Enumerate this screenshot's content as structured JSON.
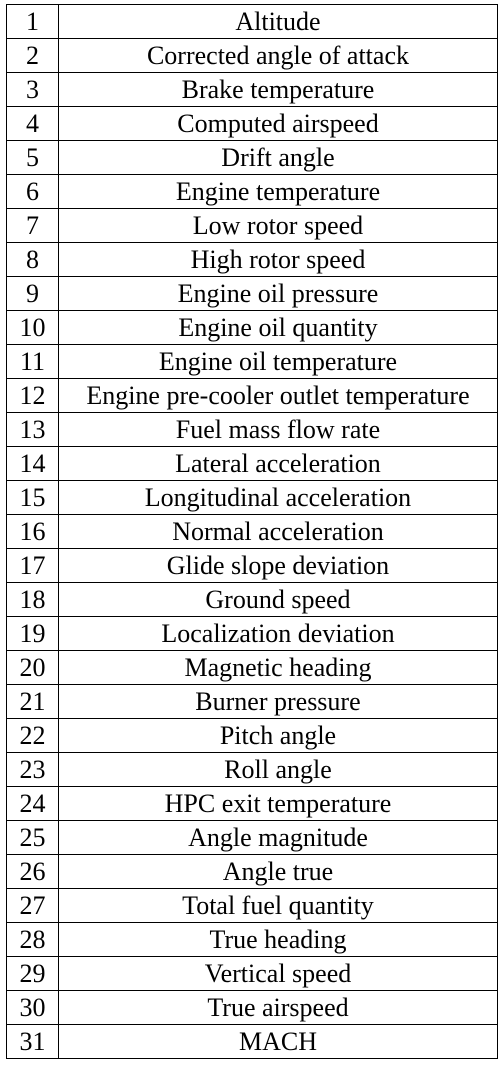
{
  "table": {
    "rows": [
      {
        "n": "1",
        "label": "Altitude"
      },
      {
        "n": "2",
        "label": "Corrected angle of attack"
      },
      {
        "n": "3",
        "label": "Brake temperature"
      },
      {
        "n": "4",
        "label": "Computed airspeed"
      },
      {
        "n": "5",
        "label": "Drift angle"
      },
      {
        "n": "6",
        "label": "Engine temperature"
      },
      {
        "n": "7",
        "label": "Low rotor speed"
      },
      {
        "n": "8",
        "label": "High rotor speed"
      },
      {
        "n": "9",
        "label": "Engine oil pressure"
      },
      {
        "n": "10",
        "label": "Engine oil quantity"
      },
      {
        "n": "11",
        "label": "Engine oil temperature"
      },
      {
        "n": "12",
        "label": "Engine pre-cooler outlet temperature"
      },
      {
        "n": "13",
        "label": "Fuel mass flow rate"
      },
      {
        "n": "14",
        "label": "Lateral acceleration"
      },
      {
        "n": "15",
        "label": "Longitudinal acceleration"
      },
      {
        "n": "16",
        "label": "Normal acceleration"
      },
      {
        "n": "17",
        "label": "Glide slope deviation"
      },
      {
        "n": "18",
        "label": "Ground speed"
      },
      {
        "n": "19",
        "label": "Localization deviation"
      },
      {
        "n": "20",
        "label": "Magnetic heading"
      },
      {
        "n": "21",
        "label": "Burner pressure"
      },
      {
        "n": "22",
        "label": "Pitch angle"
      },
      {
        "n": "23",
        "label": "Roll angle"
      },
      {
        "n": "24",
        "label": "HPC exit temperature"
      },
      {
        "n": "25",
        "label": "Angle magnitude"
      },
      {
        "n": "26",
        "label": "Angle true"
      },
      {
        "n": "27",
        "label": "Total fuel quantity"
      },
      {
        "n": "28",
        "label": "True heading"
      },
      {
        "n": "29",
        "label": "Vertical speed"
      },
      {
        "n": "30",
        "label": "True airspeed"
      },
      {
        "n": "31",
        "label": "MACH"
      }
    ]
  }
}
